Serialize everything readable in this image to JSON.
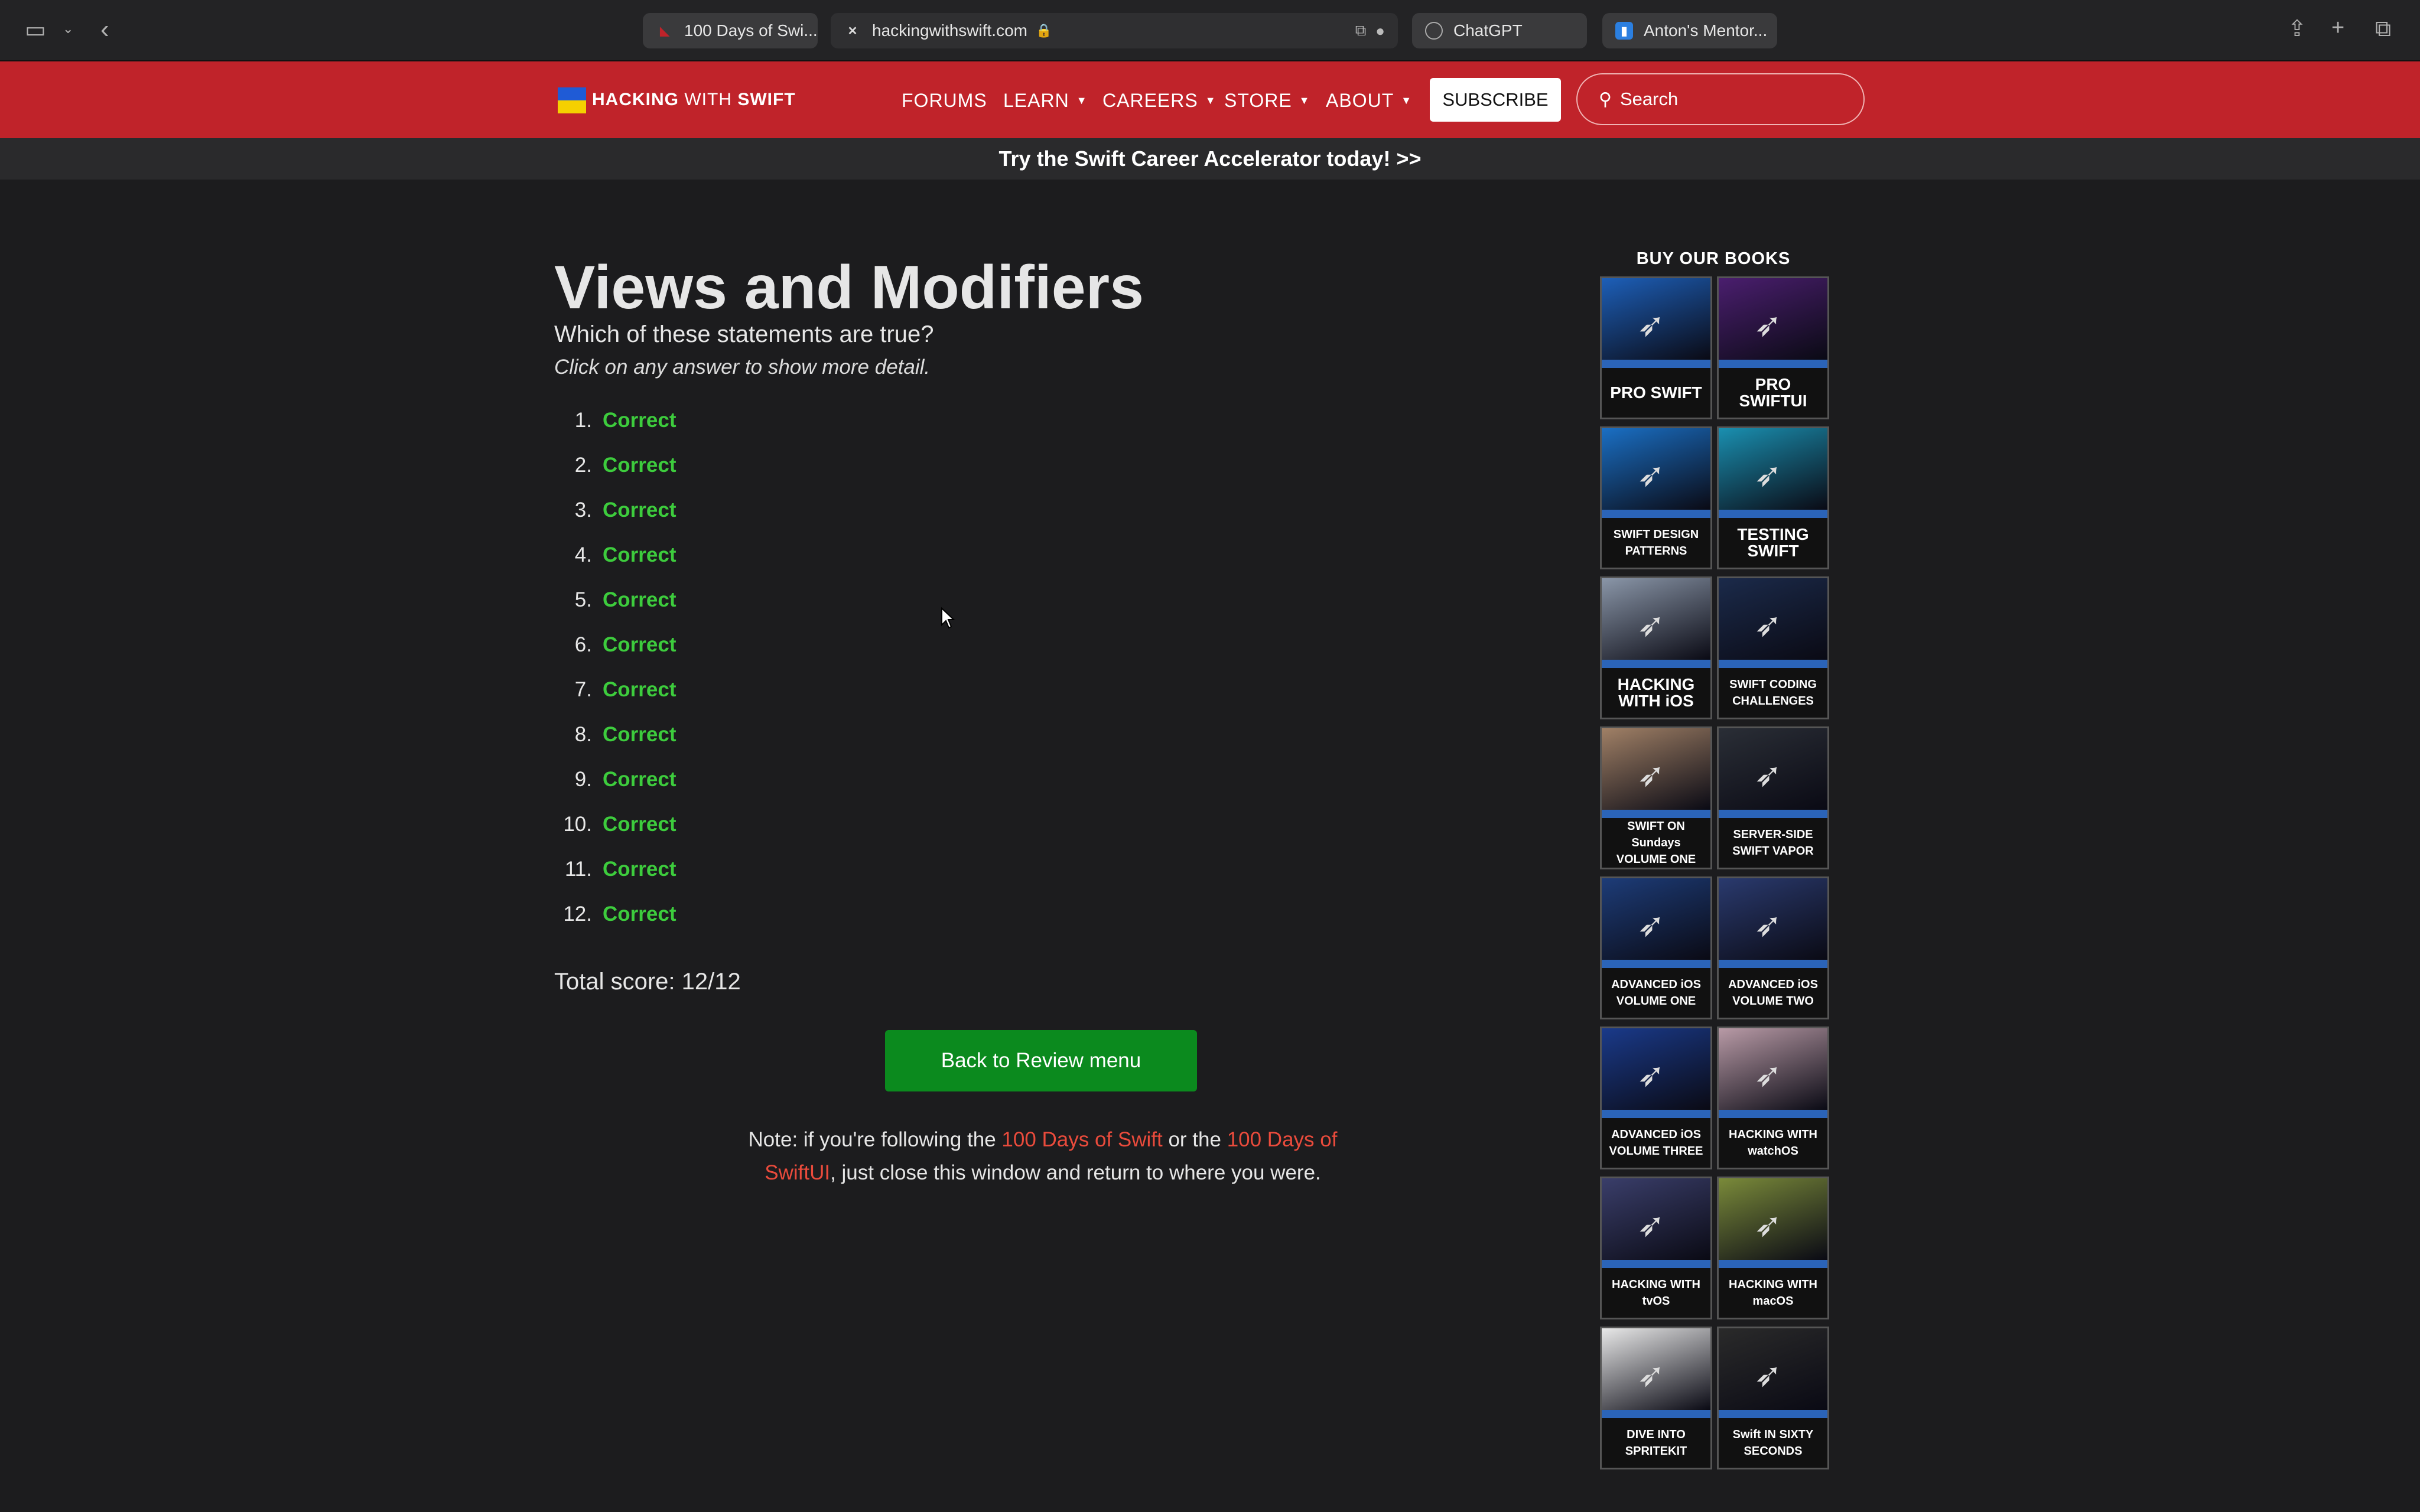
{
  "browser": {
    "tabs": [
      {
        "label": "100 Days of Swi...",
        "favicon": "hws-swift-icon"
      },
      {
        "label": "hackingwithswift.com",
        "favicon": "close-icon"
      },
      {
        "label": "ChatGPT",
        "favicon": "chatgpt-icon"
      },
      {
        "label": "Anton's Mentor...",
        "favicon": "trello-icon"
      }
    ]
  },
  "header": {
    "logo_text_bold": "HACKING",
    "logo_text_light": "WITH",
    "logo_text_end": "SWIFT",
    "nav": [
      "FORUMS",
      "LEARN",
      "CAREERS",
      "STORE",
      "ABOUT"
    ],
    "subscribe": "SUBSCRIBE",
    "search_placeholder": "Search"
  },
  "promo": "Try the Swift Career Accelerator today! >>",
  "main": {
    "title": "Views and Modifiers",
    "question": "Which of these statements are true?",
    "instruction": "Click on any answer to show more detail.",
    "answers": [
      {
        "num": "1.",
        "status": "Correct"
      },
      {
        "num": "2.",
        "status": "Correct"
      },
      {
        "num": "3.",
        "status": "Correct"
      },
      {
        "num": "4.",
        "status": "Correct"
      },
      {
        "num": "5.",
        "status": "Correct"
      },
      {
        "num": "6.",
        "status": "Correct"
      },
      {
        "num": "7.",
        "status": "Correct"
      },
      {
        "num": "8.",
        "status": "Correct"
      },
      {
        "num": "9.",
        "status": "Correct"
      },
      {
        "num": "10.",
        "status": "Correct"
      },
      {
        "num": "11.",
        "status": "Correct"
      },
      {
        "num": "12.",
        "status": "Correct"
      }
    ],
    "total_score": "Total score: 12/12",
    "back_button": "Back to Review menu",
    "note_prefix": "Note: if you're following the ",
    "note_link1": "100 Days of Swift",
    "note_mid": " or the ",
    "note_link2": "100 Days of SwiftUI",
    "note_suffix": ", just close this window and return to where you were."
  },
  "sidebar": {
    "heading": "BUY OUR BOOKS",
    "books": [
      {
        "title": "PRO SWIFT",
        "color": "#1d5fb8"
      },
      {
        "title": "PRO SWIFTUI",
        "color": "#4a1e6e"
      },
      {
        "title": "SWIFT DESIGN PATTERNS",
        "color": "#1a6fc4"
      },
      {
        "title": "TESTING SWIFT",
        "color": "#1a8fb0"
      },
      {
        "title": "HACKING WITH iOS",
        "color": "#8a96a8"
      },
      {
        "title": "SWIFT CODING CHALLENGES",
        "color": "#1b2a4a"
      },
      {
        "title": "SWIFT ON Sundays VOLUME ONE",
        "color": "#a08066"
      },
      {
        "title": "SERVER-SIDE SWIFT VAPOR",
        "color": "#2a2e36"
      },
      {
        "title": "ADVANCED iOS VOLUME ONE",
        "color": "#1d3c78"
      },
      {
        "title": "ADVANCED iOS VOLUME TWO",
        "color": "#2a3a6e"
      },
      {
        "title": "ADVANCED iOS VOLUME THREE",
        "color": "#1a3a8a"
      },
      {
        "title": "HACKING WITH watchOS",
        "color": "#b89aa6"
      },
      {
        "title": "HACKING WITH tvOS",
        "color": "#3a3e6a"
      },
      {
        "title": "HACKING WITH macOS",
        "color": "#7a8a3a"
      },
      {
        "title": "DIVE INTO SPRITEKIT",
        "color": "#e8e8e8"
      },
      {
        "title": "Swift IN SIXTY SECONDS",
        "color": "#2a2a2a"
      }
    ]
  },
  "colors": {
    "brand_red": "#c0232a",
    "correct_green": "#3dcc3d",
    "button_green": "#0b8a1e",
    "link_red": "#ea4b3c"
  }
}
